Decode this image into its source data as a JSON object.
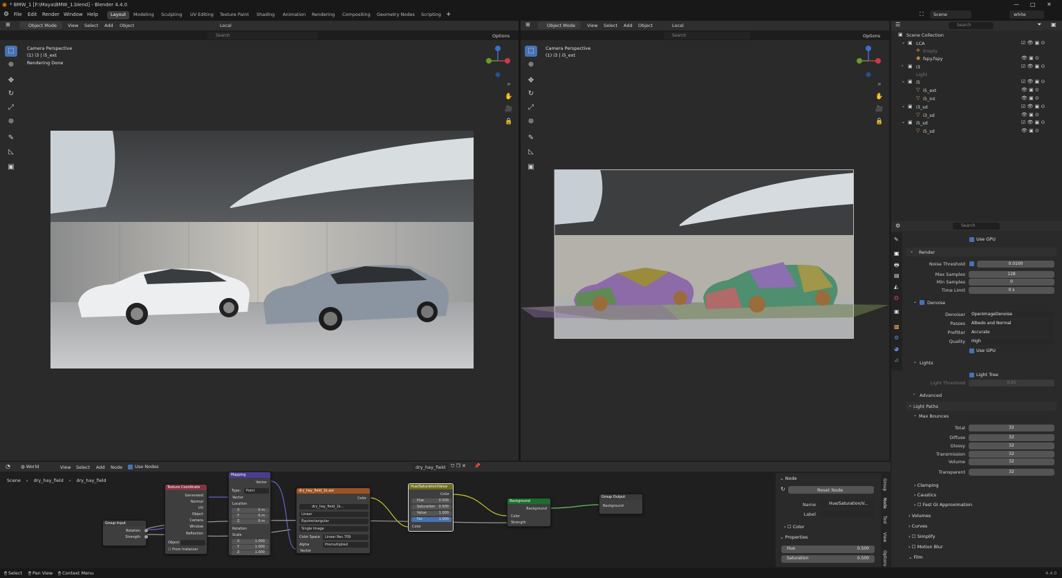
{
  "window": {
    "title": "* BMW_1 [F:\\Maya\\BMW_1.blend] - Blender 4.4.0",
    "controls": [
      "—",
      "□",
      "✕"
    ]
  },
  "menu": [
    "File",
    "Edit",
    "Render",
    "Window",
    "Help"
  ],
  "workspaces": [
    "Layout",
    "Modeling",
    "Sculpting",
    "UV Editing",
    "Texture Paint",
    "Shading",
    "Animation",
    "Rendering",
    "Compositing",
    "Geometry Nodes",
    "Scripting"
  ],
  "scene": {
    "name": "Scene",
    "view_layer": "white"
  },
  "viewport_left": {
    "mode": "Object Mode",
    "menus": [
      "View",
      "Select",
      "Add",
      "Object"
    ],
    "transform": "Local",
    "search_placeholder": "Search",
    "options": "Options",
    "overlay_text": [
      "Camera Perspective",
      "(1) i3 | i5_ext",
      "Rendering Done"
    ]
  },
  "viewport_right": {
    "mode": "Object Mode",
    "menus": [
      "View",
      "Select",
      "Add",
      "Object"
    ],
    "transform": "Local",
    "search_placeholder": "Search",
    "options": "Options",
    "overlay_text": [
      "Camera Perspective",
      "(1) i3 | i5_ext"
    ]
  },
  "outliner": {
    "search_placeholder": "Search",
    "items": [
      {
        "label": "Scene Collection",
        "indent": 0,
        "dim": false
      },
      {
        "label": "LCA",
        "indent": 1,
        "dim": false
      },
      {
        "label": "Empty",
        "indent": 2,
        "dim": true
      },
      {
        "label": "fspy.fspy",
        "indent": 2,
        "dim": false
      },
      {
        "label": "i3",
        "indent": 1,
        "dim": false
      },
      {
        "label": "Light",
        "indent": 1,
        "dim": true
      },
      {
        "label": "i5",
        "indent": 1,
        "dim": false
      },
      {
        "label": "i5_ext",
        "indent": 2,
        "dim": false
      },
      {
        "label": "i5_int",
        "indent": 2,
        "dim": false
      },
      {
        "label": "i3_sd",
        "indent": 1,
        "dim": false
      },
      {
        "label": "i3_sd",
        "indent": 2,
        "dim": false
      },
      {
        "label": "i5_sd",
        "indent": 1,
        "dim": false
      },
      {
        "label": "i5_sd",
        "indent": 2,
        "dim": false
      }
    ]
  },
  "properties": {
    "search_placeholder": "Search",
    "use_gpu_top": "Use GPU",
    "render_section": "Render",
    "noise_threshold": {
      "label": "Noise Threshold",
      "value": "0.0100"
    },
    "max_samples": {
      "label": "Max Samples",
      "value": "128"
    },
    "min_samples": {
      "label": "Min Samples",
      "value": "0"
    },
    "time_limit": {
      "label": "Time Limit",
      "value": "0 s"
    },
    "denoise_section": "Denoise",
    "denoiser": {
      "label": "Denoiser",
      "value": "OpenImageDenoise"
    },
    "passes": {
      "label": "Passes",
      "value": "Albedo and Normal"
    },
    "prefilter": {
      "label": "Prefilter",
      "value": "Accurate"
    },
    "quality": {
      "label": "Quality",
      "value": "High"
    },
    "use_gpu": "Use GPU",
    "lights_section": "Lights",
    "light_tree": "Light Tree",
    "light_threshold": {
      "label": "Light Threshold",
      "value": "0.01"
    },
    "advanced": "Advanced",
    "light_paths": "Light Paths",
    "max_bounces": "Max Bounces",
    "bounces": [
      {
        "label": "Total",
        "value": "32"
      },
      {
        "label": "Diffuse",
        "value": "32"
      },
      {
        "label": "Glossy",
        "value": "32"
      },
      {
        "label": "Transmission",
        "value": "32"
      },
      {
        "label": "Volume",
        "value": "32"
      },
      {
        "label": "Transparent",
        "value": "32"
      }
    ],
    "clamping": "Clamping",
    "caustics": "Caustics",
    "fast_gi": "Fast GI Approximation",
    "volumes": "Volumes",
    "curves": "Curves",
    "simplify": "Simplify",
    "motion_blur": "Motion Blur",
    "film": "Film"
  },
  "node_editor": {
    "type": "World",
    "menus": [
      "View",
      "Select",
      "Add",
      "Node"
    ],
    "use_nodes": "Use Nodes",
    "datablock": "dry_hay_field",
    "breadcrumb": [
      "Scene",
      "dry_hay_field",
      "dry_hay_field"
    ],
    "nodes": {
      "group_input": {
        "title": "Group Input",
        "rows": [
          "Rotation",
          "Strength"
        ]
      },
      "texcoord": {
        "title": "Texture Coordinate",
        "rows": [
          "Generated",
          "Normal",
          "UV",
          "Object",
          "Camera",
          "Window",
          "Reflection"
        ],
        "object_label": "Object",
        "from_instancer": "From Instancer"
      },
      "mapping": {
        "title": "Mapping",
        "out": "Vector",
        "type_label": "Type:",
        "type_value": "Point",
        "rows": [
          "Vector",
          "Location",
          "Rotation",
          "Scale"
        ],
        "loc": [
          "X",
          "Y",
          "Z"
        ],
        "loc_vals": [
          "0 m",
          "0 m",
          "0 m"
        ],
        "scale_vals": [
          "1.000",
          "1.000",
          "1.000"
        ]
      },
      "envtex": {
        "title": "dry_hay_field_1k.exr",
        "out": "Color",
        "image": "dry_hay_field_1k...",
        "interp": "Linear",
        "proj": "Equirectangular",
        "src": "Single Image",
        "cs_label": "Color Space",
        "cs_value": "Linear Rec.709",
        "alpha_label": "Alpha",
        "alpha_value": "Premultiplied",
        "vec": "Vector"
      },
      "hsv": {
        "title": "Hue/Saturation/Value",
        "out": "Color",
        "rows": [
          {
            "label": "Hue",
            "value": "0.500"
          },
          {
            "label": "Saturation",
            "value": "0.500"
          },
          {
            "label": "Value",
            "value": "1.000"
          },
          {
            "label": "Fac",
            "value": "1.000"
          }
        ],
        "in": "Color"
      },
      "background": {
        "title": "Background",
        "out": "Background",
        "rows": [
          "Color",
          "Strength"
        ]
      },
      "group_output": {
        "title": "Group Output",
        "rows": [
          "Background"
        ]
      }
    }
  },
  "node_sidebar": {
    "section": "Node",
    "reset": "Reset Node",
    "name_label": "Name",
    "name_value": "Hue/Saturation/V...",
    "label_label": "Label",
    "color": "Color",
    "properties": "Properties",
    "hue": {
      "label": "Hue",
      "value": "0.500"
    },
    "saturation": {
      "label": "Saturation",
      "value": "0.500"
    },
    "tabs": [
      "Group",
      "Node",
      "Tool",
      "View",
      "Options"
    ]
  },
  "statusbar": {
    "items": [
      "Select",
      "Pan View",
      "Context Menu"
    ],
    "version": "4.4.0"
  },
  "colors": {
    "accent": "#4772b3",
    "node_texcoord": "#833442",
    "node_mapping": "#4c3c8f",
    "node_envtex": "#9c5224",
    "node_hsv": "#6e6d1a",
    "node_background": "#1b6e2d",
    "node_group": "#3a3a3a"
  }
}
